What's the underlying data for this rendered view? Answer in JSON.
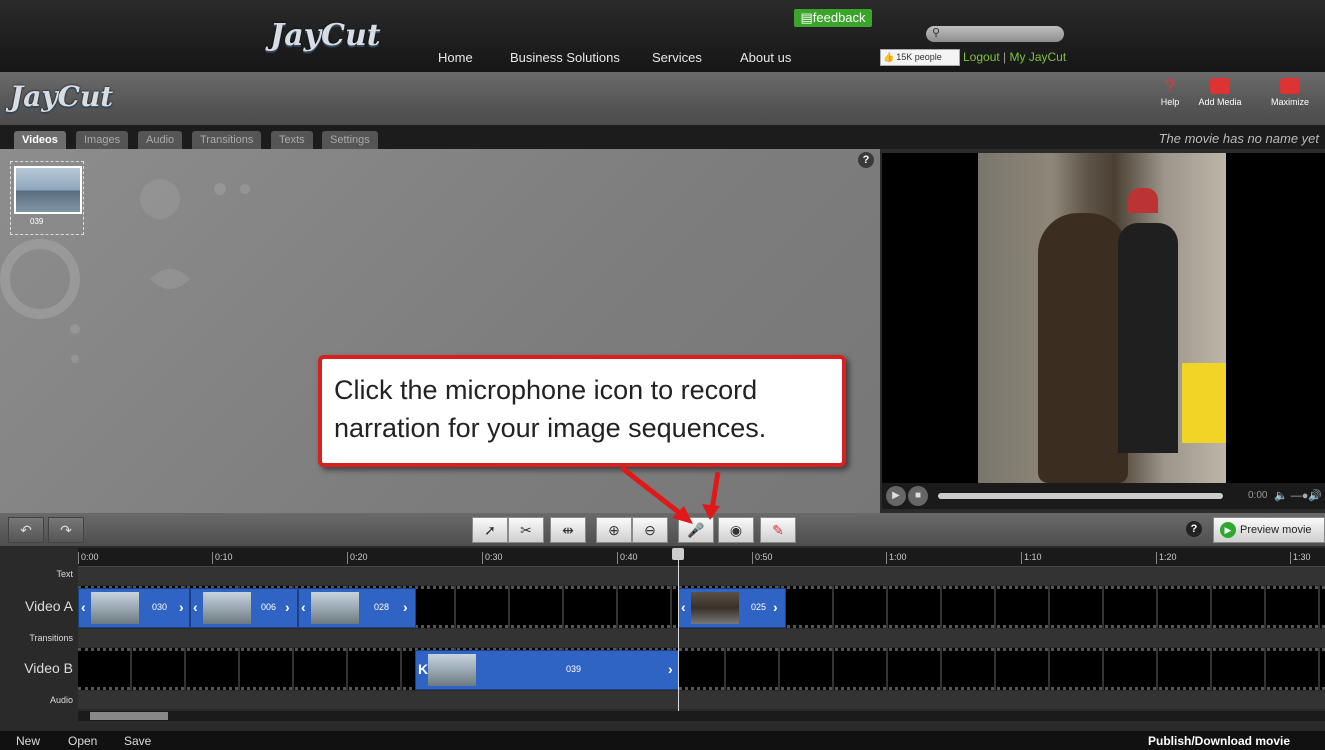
{
  "topnav": {
    "logo": "JayCut",
    "links": [
      "Home",
      "Business Solutions",
      "Services",
      "About us"
    ],
    "feedback": "feedback",
    "like": "15K people",
    "logout": "Logout",
    "separator": " | ",
    "myjaycut": "My JayCut"
  },
  "header": {
    "logo": "JayCut",
    "help": "Help",
    "add_media": "Add Media",
    "maximize": "Maximize"
  },
  "tabs": [
    "Videos",
    "Images",
    "Audio",
    "Transitions",
    "Texts",
    "Settings"
  ],
  "movie_name": "The movie has no name yet",
  "media": {
    "thumb_label": "039",
    "help": "?"
  },
  "player": {
    "time": "0:00"
  },
  "toolbar": {
    "help": "?",
    "preview": "Preview movie"
  },
  "timeline": {
    "ticks": [
      "0:00",
      "0:10",
      "0:20",
      "0:30",
      "0:40",
      "0:50",
      "1:00",
      "1:10",
      "1:20",
      "1:30"
    ],
    "rows": [
      "Text",
      "Video A",
      "Transitions",
      "Video B",
      "Audio"
    ],
    "video_a_clips": [
      "030",
      "006",
      "028",
      "025"
    ],
    "video_b_clip": "039"
  },
  "bottom": {
    "new": "New",
    "open": "Open",
    "save": "Save",
    "publish": "Publish/Download movie"
  },
  "callout": {
    "line1": "Click the microphone icon to record",
    "line2": "narration for your image sequences."
  },
  "colors": {
    "accent_green": "#3aa52a",
    "clip_blue": "#2f63c4",
    "callout_red": "#d92020"
  }
}
